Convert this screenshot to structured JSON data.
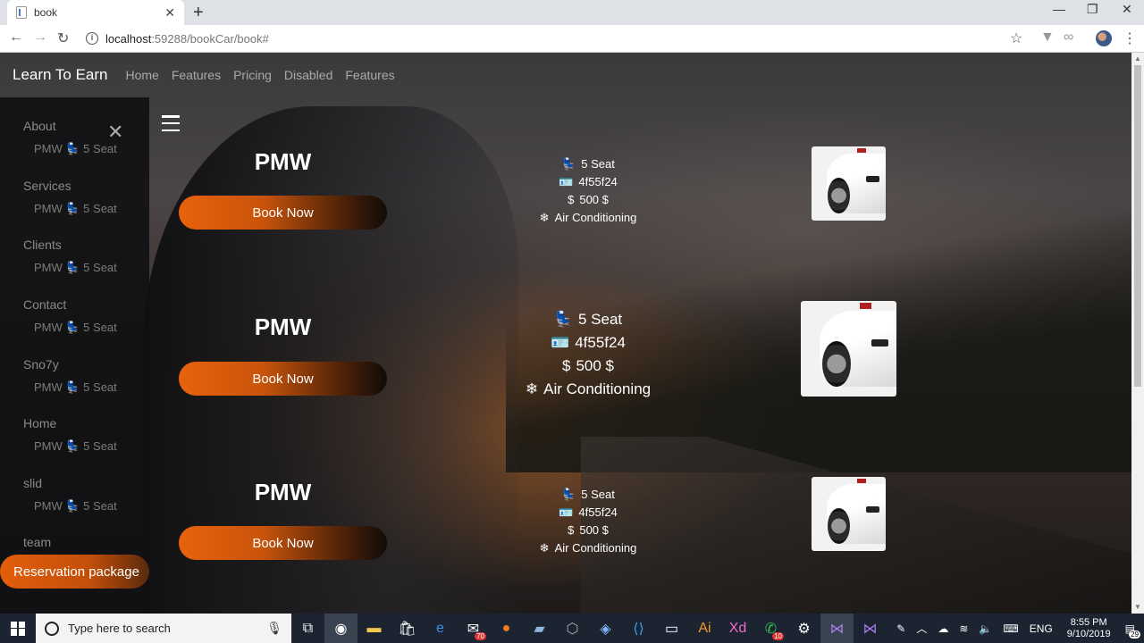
{
  "browser": {
    "tab_title": "book",
    "tab_close": "✕",
    "new_tab": "+",
    "url_host": "localhost",
    "url_rest": ":59288/bookCar/book#",
    "window_controls": [
      "—",
      "❐",
      "✕"
    ]
  },
  "navbar": {
    "brand": "Learn To Earn",
    "links": [
      "Home",
      "Features",
      "Pricing",
      "Disabled",
      "Features"
    ]
  },
  "sidebar": {
    "close": "✕",
    "sections": [
      {
        "label": "About",
        "sub": "PMW 💺 5 Seat"
      },
      {
        "label": "Services",
        "sub": "PMW 💺 5 Seat"
      },
      {
        "label": "Clients",
        "sub": "PMW 💺 5 Seat"
      },
      {
        "label": "Contact",
        "sub": "PMW 💺 5 Seat"
      },
      {
        "label": "Sno7y",
        "sub": "PMW 💺 5 Seat"
      },
      {
        "label": "Home",
        "sub": "PMW 💺 5 Seat"
      },
      {
        "label": "slid",
        "sub": "PMW 💺 5 Seat"
      },
      {
        "label": "team",
        "sub": ""
      }
    ],
    "reserve_label": "Reservation package"
  },
  "cars": [
    {
      "name": "PMW",
      "button": "Book Now",
      "seats": "5 Seat",
      "id": "4f55f24",
      "price": "500 $",
      "feature": "Air Conditioning"
    },
    {
      "name": "PMW",
      "button": "Book Now",
      "seats": "5 Seat",
      "id": "4f55f24",
      "price": "500 $",
      "feature": "Air Conditioning"
    },
    {
      "name": "PMW",
      "button": "Book Now",
      "seats": "5 Seat",
      "id": "4f55f24",
      "price": "500 $",
      "feature": "Air Conditioning"
    }
  ],
  "icons": {
    "seat": "💺",
    "id_card": "🪪",
    "price": "$",
    "fan": "❄"
  },
  "taskbar": {
    "search_placeholder": "Type here to search",
    "mail_badge": "70",
    "whatsapp_badge": "10",
    "language": "ENG",
    "time": "8:55 PM",
    "date": "9/10/2019",
    "notification_badge": "29"
  }
}
